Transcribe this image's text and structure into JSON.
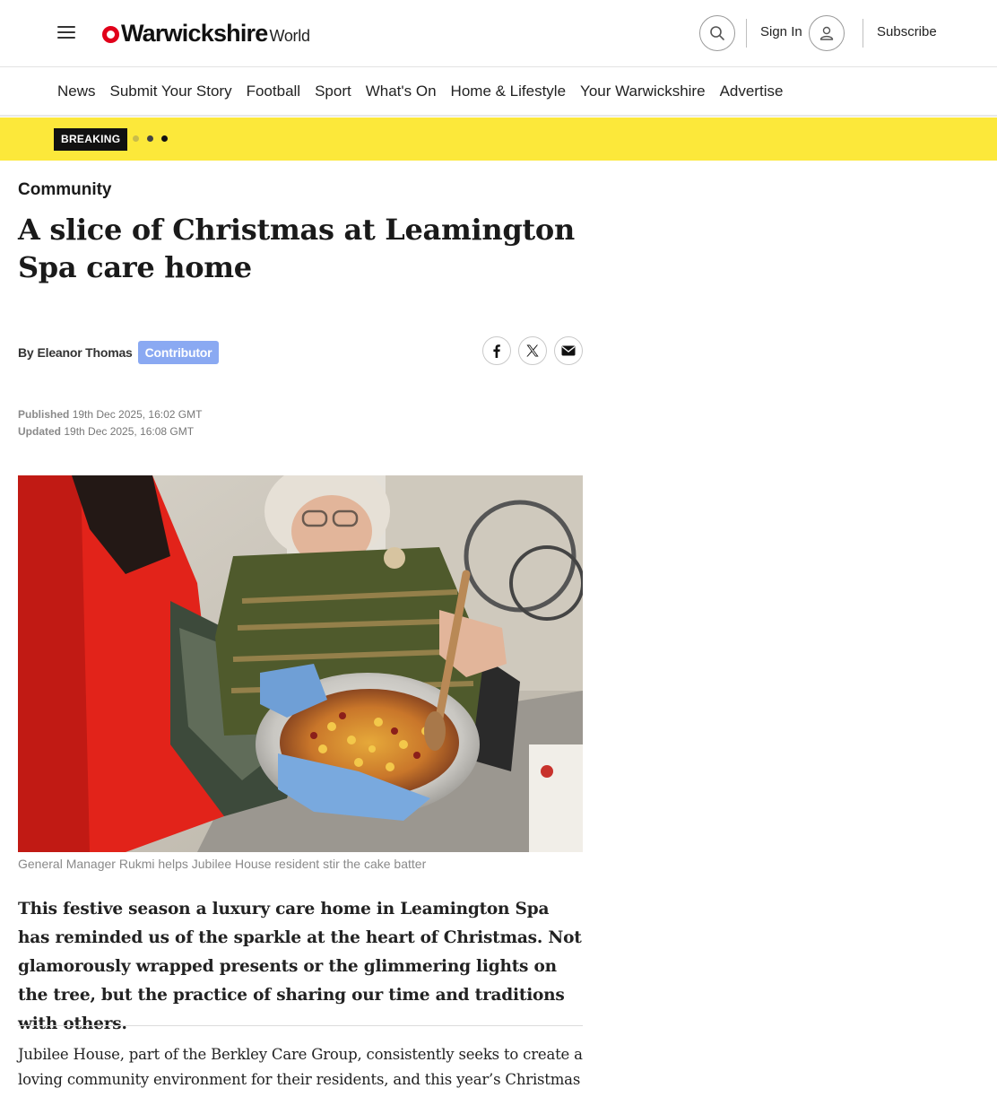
{
  "header": {
    "logo_main": "Warwickshire",
    "logo_sub": "World",
    "signin_label": "Sign In",
    "subscribe_label": "Subscribe"
  },
  "nav": {
    "items": [
      {
        "label": "News"
      },
      {
        "label": "Submit Your Story"
      },
      {
        "label": "Football"
      },
      {
        "label": "Sport"
      },
      {
        "label": "What's On"
      },
      {
        "label": "Home & Lifestyle"
      },
      {
        "label": "Your Warwickshire"
      },
      {
        "label": "Advertise"
      }
    ]
  },
  "breaking": {
    "label": "BREAKING"
  },
  "article": {
    "category": "Community",
    "title": "A slice of Christmas at Leamington Spa care home",
    "byline_prefix": "By",
    "author": "Eleanor Thomas",
    "author_role": "Contributor",
    "published_label": "Published",
    "published": "19th Dec 2025, 16:02 GMT",
    "updated_label": "Updated",
    "updated": "19th Dec 2025, 16:08 GMT",
    "image_caption": "General Manager Rukmi helps Jubilee House resident stir the cake batter",
    "standfirst": "This festive season a luxury care home in Leamington Spa has reminded us of the sparkle at the heart of Christmas. Not glamorously wrapped presents or the glimmering lights on the tree, but the practice of sharing our time and traditions with others.",
    "body": "Jubilee House, part of the Berkley Care Group, consistently seeks to create a loving community environment for their residents, and this year’s Christmas"
  },
  "icons": {
    "menu": "hamburger-menu-icon",
    "search": "search-icon",
    "user": "user-icon",
    "facebook": "facebook-icon",
    "x": "x-icon",
    "email": "email-icon"
  },
  "colors": {
    "brand_red": "#e1001a",
    "breaking_bg": "#fce83a",
    "contributor_badge": "#8aa9f2"
  }
}
